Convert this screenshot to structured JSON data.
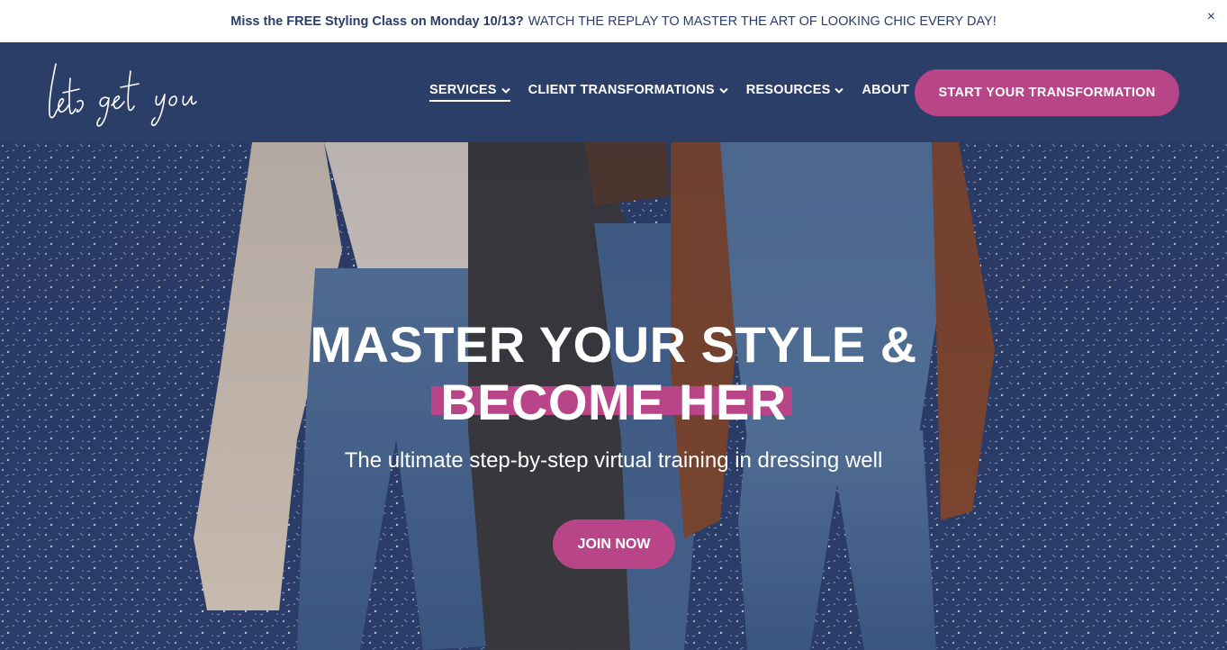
{
  "announcement": {
    "bold_text": "Miss the FREE Styling Class on Monday 10/13?",
    "text": "WATCH THE REPLAY TO MASTER THE ART OF LOOKING CHIC EVERY DAY!",
    "close_label": "×"
  },
  "header": {
    "logo_text": "lets get you",
    "nav": [
      {
        "label": "SERVICES",
        "has_dropdown": true,
        "active": true
      },
      {
        "label": "CLIENT TRANSFORMATIONS",
        "has_dropdown": true
      },
      {
        "label": "RESOURCES",
        "has_dropdown": true
      },
      {
        "label": "ABOUT",
        "has_dropdown": false
      }
    ],
    "cta_label": "START YOUR TRANSFORMATION"
  },
  "hero": {
    "title_line1": "MASTER YOUR STYLE &",
    "title_line2": "BECOME HER",
    "subtitle": "The ultimate step-by-step virtual training in dressing well",
    "button_label": "JOIN NOW"
  },
  "colors": {
    "navy": "#2b3e67",
    "accent_pink": "#b94589",
    "white": "#ffffff"
  }
}
